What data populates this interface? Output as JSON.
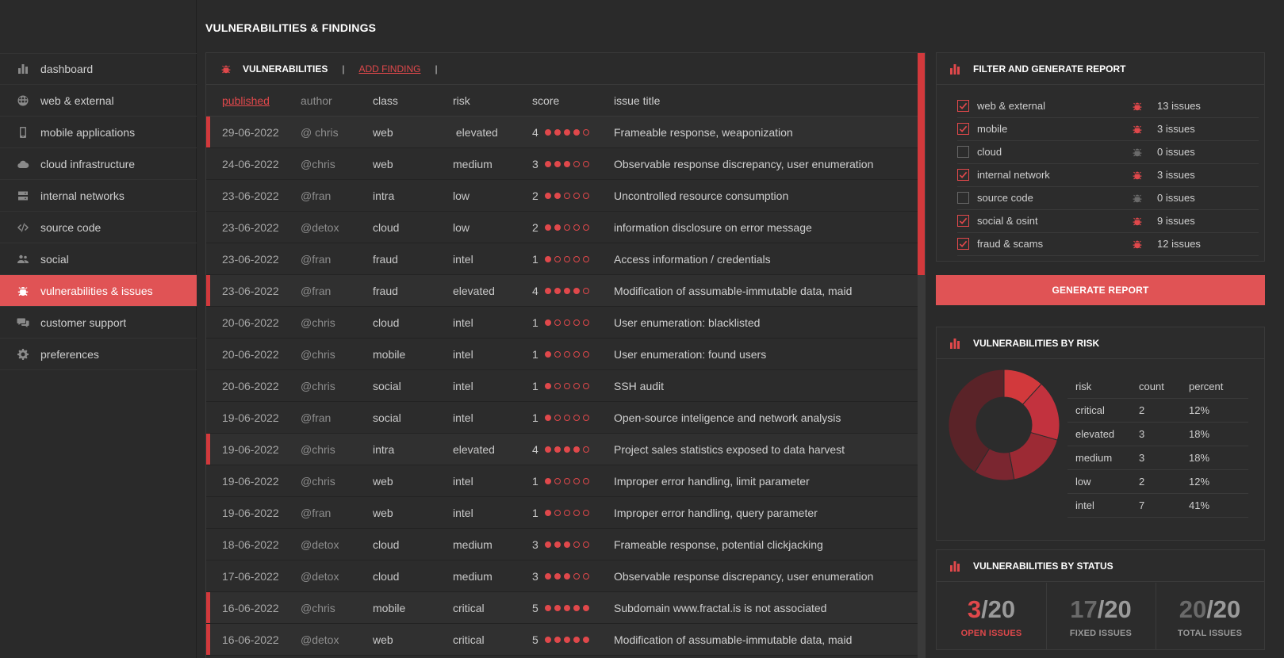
{
  "page_title": "VULNERABILITIES & FINDINGS",
  "sidebar": {
    "items": [
      {
        "label": "dashboard",
        "icon": "bar-chart-icon"
      },
      {
        "label": "web & external",
        "icon": "globe-icon"
      },
      {
        "label": "mobile applications",
        "icon": "mobile-icon"
      },
      {
        "label": "cloud infrastructure",
        "icon": "cloud-icon"
      },
      {
        "label": "internal networks",
        "icon": "server-icon"
      },
      {
        "label": "source code",
        "icon": "code-icon"
      },
      {
        "label": "social",
        "icon": "users-icon"
      },
      {
        "label": "vulnerabilities & issues",
        "icon": "bug-icon",
        "active": true
      },
      {
        "label": "customer support",
        "icon": "comments-icon"
      },
      {
        "label": "preferences",
        "icon": "gear-icon"
      }
    ]
  },
  "vulns": {
    "title": "VULNERABILITIES",
    "separator": "|",
    "add_label": "ADD FINDING",
    "columns": {
      "published": "published",
      "author": "author",
      "class": "class",
      "risk": "risk",
      "score": "score",
      "title": "issue title"
    },
    "rows": [
      {
        "date": "29-06-2022",
        "author": "@ chris",
        "class": "web",
        "risk": " elevated",
        "score": 4,
        "title": "Frameable response, weaponization",
        "hl": true
      },
      {
        "date": "24-06-2022",
        "author": "@chris",
        "class": "web",
        "risk": "medium",
        "score": 3,
        "title": "Observable response discrepancy, user enumeration",
        "hl": false
      },
      {
        "date": "23-06-2022",
        "author": "@fran",
        "class": "intra",
        "risk": "low",
        "score": 2,
        "title": "Uncontrolled resource consumption",
        "hl": false
      },
      {
        "date": "23-06-2022",
        "author": "@detox",
        "class": "cloud",
        "risk": "low",
        "score": 2,
        "title": "information disclosure on error message",
        "hl": false
      },
      {
        "date": "23-06-2022",
        "author": "@fran",
        "class": "fraud",
        "risk": "intel",
        "score": 1,
        "title": "Access information / credentials",
        "hl": false
      },
      {
        "date": "23-06-2022",
        "author": "@fran",
        "class": "fraud",
        "risk": "elevated",
        "score": 4,
        "title": "Modification of assumable-immutable data, maid",
        "hl": true
      },
      {
        "date": "20-06-2022",
        "author": "@chris",
        "class": "cloud",
        "risk": "intel",
        "score": 1,
        "title": "User enumeration: blacklisted",
        "hl": false
      },
      {
        "date": "20-06-2022",
        "author": "@chris",
        "class": "mobile",
        "risk": "intel",
        "score": 1,
        "title": "User enumeration: found users",
        "hl": false
      },
      {
        "date": "20-06-2022",
        "author": "@chris",
        "class": "social",
        "risk": "intel",
        "score": 1,
        "title": "SSH audit",
        "hl": false
      },
      {
        "date": "19-06-2022",
        "author": "@fran",
        "class": "social",
        "risk": "intel",
        "score": 1,
        "title": "Open-source inteligence and network analysis",
        "hl": false
      },
      {
        "date": "19-06-2022",
        "author": "@chris",
        "class": "intra",
        "risk": "elevated",
        "score": 4,
        "title": "Project sales statistics exposed to data harvest",
        "hl": true
      },
      {
        "date": "19-06-2022",
        "author": "@chris",
        "class": "web",
        "risk": "intel",
        "score": 1,
        "title": "Improper error handling, limit parameter",
        "hl": false
      },
      {
        "date": "19-06-2022",
        "author": "@fran",
        "class": "web",
        "risk": "intel",
        "score": 1,
        "title": "Improper error handling, query parameter",
        "hl": false
      },
      {
        "date": "18-06-2022",
        "author": "@detox",
        "class": "cloud",
        "risk": "medium",
        "score": 3,
        "title": "Frameable response, potential clickjacking",
        "hl": false
      },
      {
        "date": "17-06-2022",
        "author": "@detox",
        "class": "cloud",
        "risk": "medium",
        "score": 3,
        "title": "Observable response discrepancy, user enumeration",
        "hl": false
      },
      {
        "date": "16-06-2022",
        "author": "@chris",
        "class": "mobile",
        "risk": "critical",
        "score": 5,
        "title": "Subdomain www.fractal.is is not associated",
        "hl": true
      },
      {
        "date": "16-06-2022",
        "author": "@detox",
        "class": "web",
        "risk": "critical",
        "score": 5,
        "title": "Modification of assumable-immutable data, maid",
        "hl": true
      }
    ]
  },
  "filter": {
    "title": "FILTER AND GENERATE REPORT",
    "items": [
      {
        "label": "web & external",
        "checked": true,
        "count": "13 issues"
      },
      {
        "label": "mobile",
        "checked": true,
        "count": "3 issues"
      },
      {
        "label": "cloud",
        "checked": false,
        "count": "0 issues"
      },
      {
        "label": "internal network",
        "checked": true,
        "count": "3 issues"
      },
      {
        "label": "source code",
        "checked": false,
        "count": "0 issues"
      },
      {
        "label": "social & osint",
        "checked": true,
        "count": "9 issues"
      },
      {
        "label": "fraud & scams",
        "checked": true,
        "count": "12 issues"
      }
    ],
    "button": "GENERATE REPORT"
  },
  "risk": {
    "title": "VULNERABILITIES BY RISK",
    "headers": {
      "risk": "risk",
      "count": "count",
      "percent": "percent"
    },
    "rows": [
      {
        "risk": "critical",
        "count": "2",
        "percent": "12%",
        "color": "#d2393c"
      },
      {
        "risk": "elevated",
        "count": "3",
        "percent": "18%",
        "color": "#c2323e"
      },
      {
        "risk": "medium",
        "count": "3",
        "percent": "18%",
        "color": "#9c2a34"
      },
      {
        "risk": "low",
        "count": "2",
        "percent": "12%",
        "color": "#7a2630"
      },
      {
        "risk": "intel",
        "count": "7",
        "percent": "41%",
        "color": "#5a2328"
      }
    ]
  },
  "status": {
    "title": "VULNERABILITIES BY STATUS",
    "items": [
      {
        "value": "3",
        "total": "/20",
        "label": "OPEN ISSUES",
        "color": "#e0484b",
        "label_color": "#e0484b"
      },
      {
        "value": "17",
        "total": "/20",
        "label": "FIXED ISSUES",
        "color": "#6a6a6a",
        "label_color": "#9a9a9a"
      },
      {
        "value": "20",
        "total": "/20",
        "label": "TOTAL ISSUES",
        "color": "#6a6a6a",
        "label_color": "#9a9a9a"
      }
    ]
  },
  "colors": {
    "accent": "#e05355",
    "accent_dark": "#d2393c",
    "background": "#2a2a2a"
  }
}
